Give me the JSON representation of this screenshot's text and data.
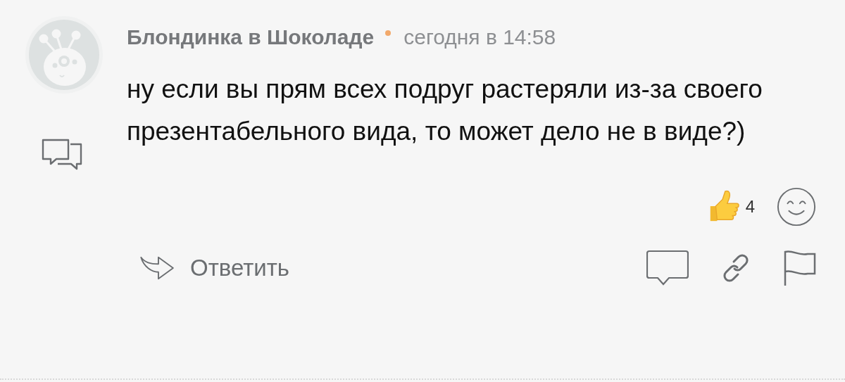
{
  "comment": {
    "author": "Блондинка в Шоколаде",
    "time": "сегодня в 14:58",
    "text": "ну если вы прям всех подруг растеряли из-за своего презентабельного вида, то может дело не в виде?)",
    "like_count": "4"
  },
  "actions": {
    "reply": "Ответить"
  }
}
